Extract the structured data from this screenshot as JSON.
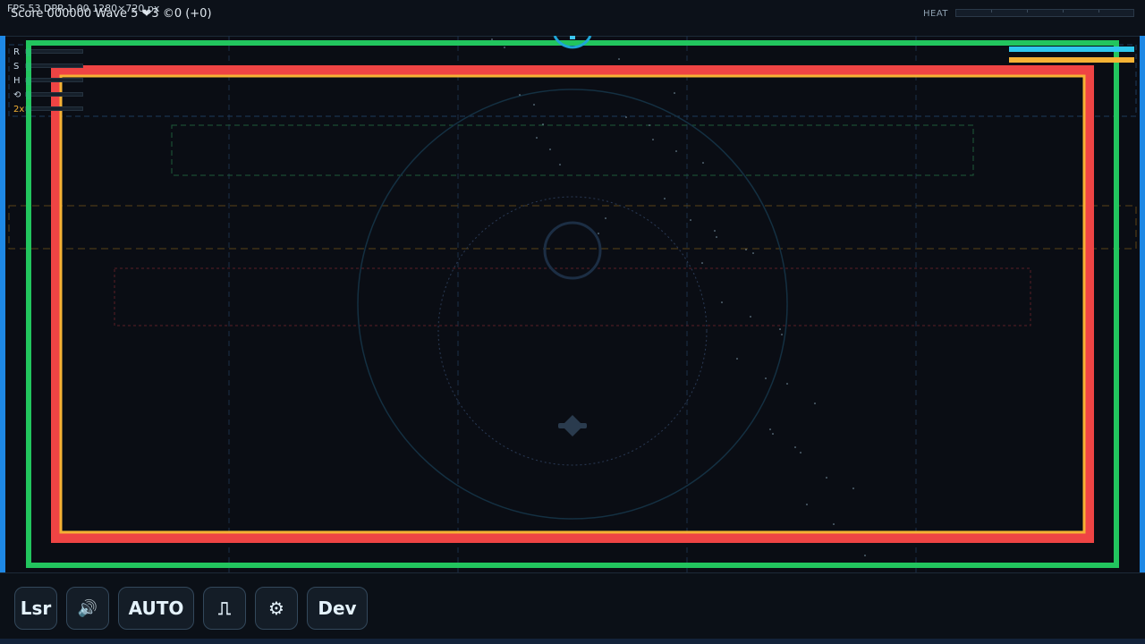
{
  "hud": {
    "fps_text": "FPS 53 DPR 1.00 1280×720 px",
    "score_text": "Score 000000  Wave 5  ❤3  ©0 (+0)",
    "heat_label": "HEAT",
    "heat_level": 0.0,
    "meters": [
      {
        "name": "shield-meter",
        "color": "#2fc8ee",
        "level": 1.0
      },
      {
        "name": "energy-meter",
        "color": "#f5b234",
        "level": 1.0
      }
    ]
  },
  "side_stats": [
    {
      "label": "R",
      "level": 0.08
    },
    {
      "label": "S",
      "level": 0.08
    },
    {
      "label": "H",
      "level": 0.08
    },
    {
      "label": "⟲",
      "level": 0.08
    },
    {
      "label": "2x",
      "level": 0.08
    }
  ],
  "controls": [
    {
      "label": "Lsr",
      "icon": null,
      "name": "laser-button"
    },
    {
      "label": "🔊",
      "icon": "speaker-icon",
      "name": "sound-button"
    },
    {
      "label": "AUTO",
      "icon": null,
      "name": "auto-fire-button"
    },
    {
      "label": "⎍",
      "icon": "pulse-icon",
      "name": "pulse-button"
    },
    {
      "label": "⚙",
      "icon": "gear-icon",
      "name": "settings-button"
    },
    {
      "label": "Dev",
      "icon": null,
      "name": "dev-button"
    }
  ],
  "colors": {
    "accent": "#1e88e5",
    "outer_border": "#22c55e",
    "inner_border": "#ef4444",
    "innermost_border": "#f5b234",
    "background": "#0a0d14"
  }
}
